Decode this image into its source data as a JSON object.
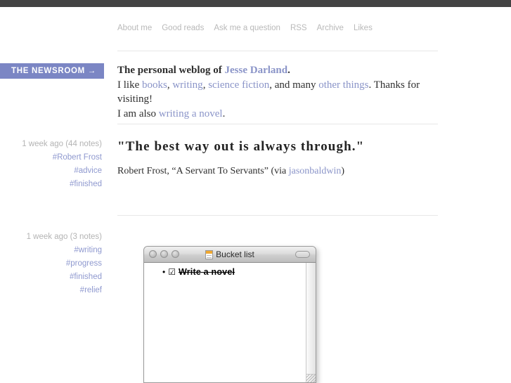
{
  "topbar": {
    "color": "#434343"
  },
  "sidebar": {
    "newsroom_label": "THE NEWSROOM →",
    "posts_meta": [
      {
        "time": "1 week ago (44 notes)",
        "tags": [
          "#Robert Frost",
          "#advice",
          "#finished"
        ]
      },
      {
        "time": "1 week ago (3 notes)",
        "tags": [
          "#writing",
          "#progress",
          "#finished",
          "#relief"
        ]
      }
    ]
  },
  "nav": {
    "items": [
      {
        "label": "About me"
      },
      {
        "label": "Good reads"
      },
      {
        "label": "Ask me a question"
      },
      {
        "label": "RSS"
      },
      {
        "label": "Archive"
      },
      {
        "label": "Likes"
      }
    ]
  },
  "intro": {
    "lead_prefix": "The personal weblog of ",
    "lead_link": "Jesse Darland",
    "lead_suffix": ".",
    "line2_a": "I like ",
    "link_books": "books",
    "line2_b": ", ",
    "link_writing": "writing",
    "line2_c": ", ",
    "link_scifi": "science fiction",
    "line2_d": ", and many ",
    "link_other": "other things",
    "line2_e": ". Thanks for visiting!",
    "line3_a": "I am also ",
    "link_novel": "writing a novel",
    "line3_b": "."
  },
  "quote_post": {
    "text": "\"The best way out is always through.\"",
    "source_prefix": "Robert Frost, “A Servant To Servants” (via ",
    "source_link": "jasonbaldwin",
    "source_suffix": ")"
  },
  "photo_post": {
    "window": {
      "title": "Bucket list",
      "doc_icon": "document-icon",
      "list_items": [
        {
          "bullet": "•",
          "checkbox": "☑",
          "text": "Write a novel"
        }
      ]
    }
  },
  "colors": {
    "link": "#8a94c8",
    "tag": "#8f99cf",
    "banner": "#7b86c4",
    "meta_time": "#b4b4b4",
    "nav": "#b9b9b9",
    "rule": "#e7e7e7"
  }
}
